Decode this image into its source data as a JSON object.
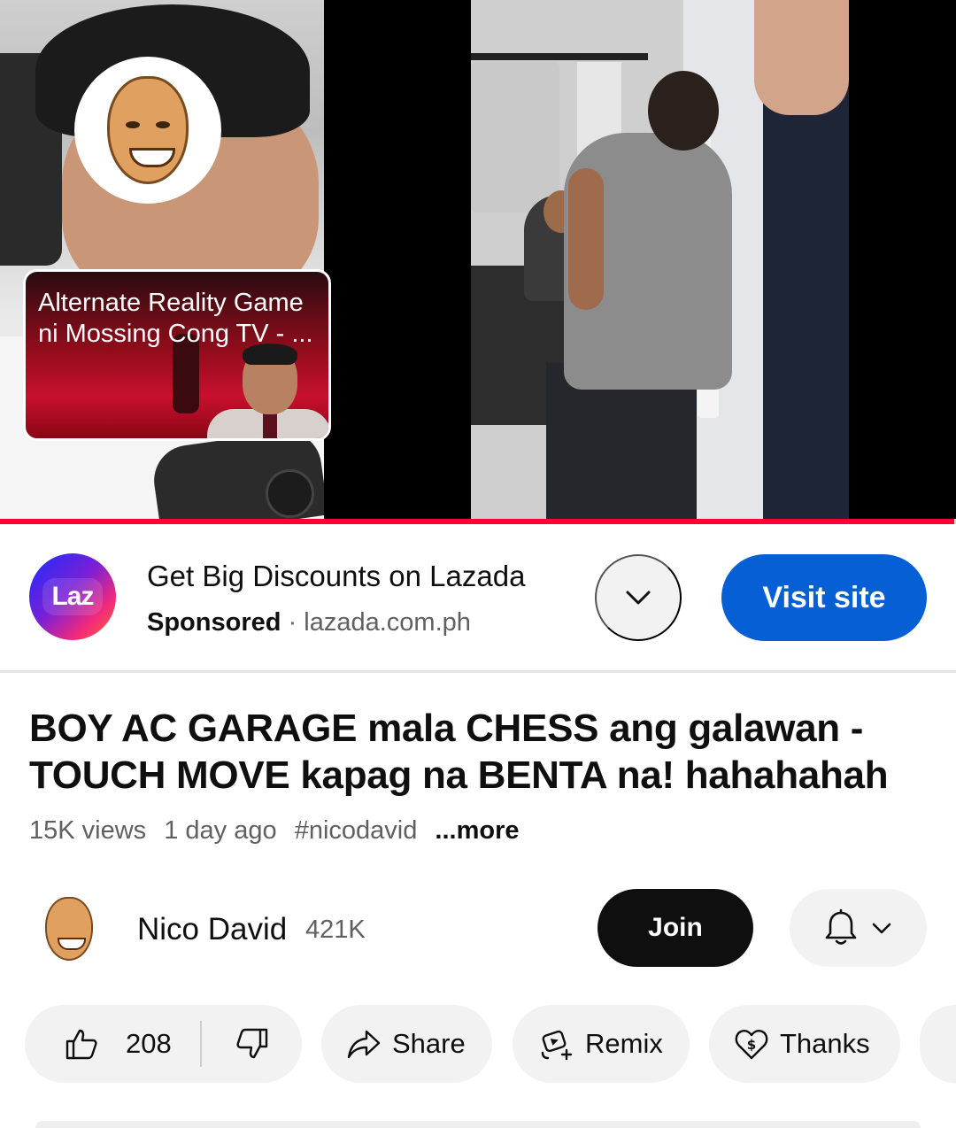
{
  "player": {
    "end_card_title": "Alternate Reality Game ni Mossing Cong TV - ...",
    "progress_fraction": 0.998,
    "progress_color": "#ff0033"
  },
  "ad": {
    "logo_text": "Laz",
    "title": "Get Big Discounts on Lazada",
    "sponsored_label": "Sponsored",
    "separator": "·",
    "domain": "lazada.com.ph",
    "expand_icon": "chevron-down-icon",
    "cta_label": "Visit site",
    "cta_color": "#065fd4"
  },
  "video": {
    "title": "BOY AC GARAGE mala CHESS ang galawan - TOUCH MOVE kapag na BENTA na! hahahahah",
    "views": "15K views",
    "age": "1 day ago",
    "hashtag": "#nicodavid",
    "more_label": "...more"
  },
  "channel": {
    "name": "Nico David",
    "subscribers": "421K",
    "join_label": "Join",
    "bell_icon": "bell-icon"
  },
  "actions": {
    "like_count": "208",
    "share_label": "Share",
    "remix_label": "Remix",
    "thanks_label": "Thanks"
  }
}
